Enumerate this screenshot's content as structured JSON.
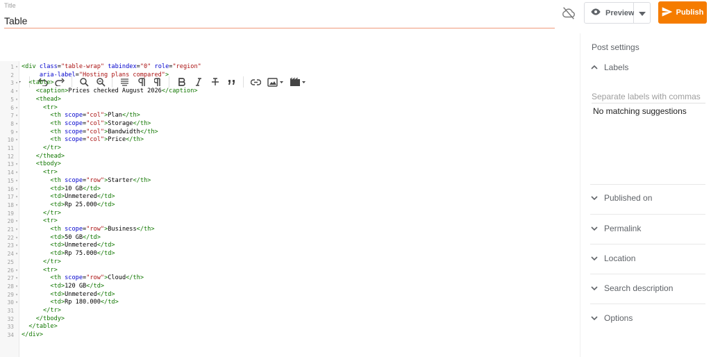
{
  "header": {
    "title_label": "Title",
    "title_value": "Table",
    "cloud_icon": "cloud-off-icon",
    "preview_label": "Preview",
    "publish_label": "Publish",
    "accent_color": "#f57c00"
  },
  "toolbar": {
    "icons": [
      "code-view-icon",
      "undo-icon",
      "redo-icon",
      "search-icon",
      "find-replace-icon",
      "align-icon",
      "paragraph-icon",
      "paragraph-rtl-icon",
      "bold-icon",
      "italic-icon",
      "strikethrough-icon",
      "quote-icon",
      "link-icon",
      "image-icon",
      "video-icon"
    ]
  },
  "editor": {
    "lines": [
      {
        "n": "1",
        "fold": true
      },
      {
        "n": "2",
        "fold": false
      },
      {
        "n": "3",
        "fold": true
      },
      {
        "n": "4",
        "fold": true
      },
      {
        "n": "5",
        "fold": true
      },
      {
        "n": "6",
        "fold": true
      },
      {
        "n": "7",
        "fold": true
      },
      {
        "n": "8",
        "fold": true
      },
      {
        "n": "9",
        "fold": true
      },
      {
        "n": "10",
        "fold": true
      },
      {
        "n": "11",
        "fold": false
      },
      {
        "n": "12",
        "fold": false
      },
      {
        "n": "13",
        "fold": true
      },
      {
        "n": "14",
        "fold": true
      },
      {
        "n": "15",
        "fold": true
      },
      {
        "n": "16",
        "fold": true
      },
      {
        "n": "17",
        "fold": true
      },
      {
        "n": "18",
        "fold": true
      },
      {
        "n": "19",
        "fold": false
      },
      {
        "n": "20",
        "fold": true
      },
      {
        "n": "21",
        "fold": true
      },
      {
        "n": "22",
        "fold": true
      },
      {
        "n": "23",
        "fold": true
      },
      {
        "n": "24",
        "fold": true
      },
      {
        "n": "25",
        "fold": false
      },
      {
        "n": "26",
        "fold": true
      },
      {
        "n": "27",
        "fold": true
      },
      {
        "n": "28",
        "fold": true
      },
      {
        "n": "29",
        "fold": true
      },
      {
        "n": "30",
        "fold": true
      },
      {
        "n": "31",
        "fold": false
      },
      {
        "n": "32",
        "fold": false
      },
      {
        "n": "33",
        "fold": false
      },
      {
        "n": "34",
        "fold": false
      }
    ],
    "code": [
      "<div class=\"table-wrap\" tabindex=\"0\" role=\"region\"",
      "     aria-label=\"Hosting plans compared\">",
      "  <table>",
      "    <caption>Prices checked August 2026</caption>",
      "    <thead>",
      "      <tr>",
      "        <th scope=\"col\">Plan</th>",
      "        <th scope=\"col\">Storage</th>",
      "        <th scope=\"col\">Bandwidth</th>",
      "        <th scope=\"col\">Price</th>",
      "      </tr>",
      "    </thead>",
      "    <tbody>",
      "      <tr>",
      "        <th scope=\"row\">Starter</th>",
      "        <td>10 GB</td>",
      "        <td>Unmetered</td>",
      "        <td>Rp 25.000</td>",
      "      </tr>",
      "      <tr>",
      "        <th scope=\"row\">Business</th>",
      "        <td>50 GB</td>",
      "        <td>Unmetered</td>",
      "        <td>Rp 75.000</td>",
      "      </tr>",
      "      <tr>",
      "        <th scope=\"row\">Cloud</th>",
      "        <td>120 GB</td>",
      "        <td>Unmetered</td>",
      "        <td>Rp 180.000</td>",
      "      </tr>",
      "    </tbody>",
      "  </table>",
      "</div>"
    ]
  },
  "sidebar": {
    "title": "Post settings",
    "labels": {
      "heading": "Labels",
      "placeholder": "Separate labels with commas",
      "no_match": "No matching suggestions"
    },
    "sections": [
      {
        "label": "Published on"
      },
      {
        "label": "Permalink"
      },
      {
        "label": "Location"
      },
      {
        "label": "Search description"
      },
      {
        "label": "Options"
      }
    ]
  }
}
